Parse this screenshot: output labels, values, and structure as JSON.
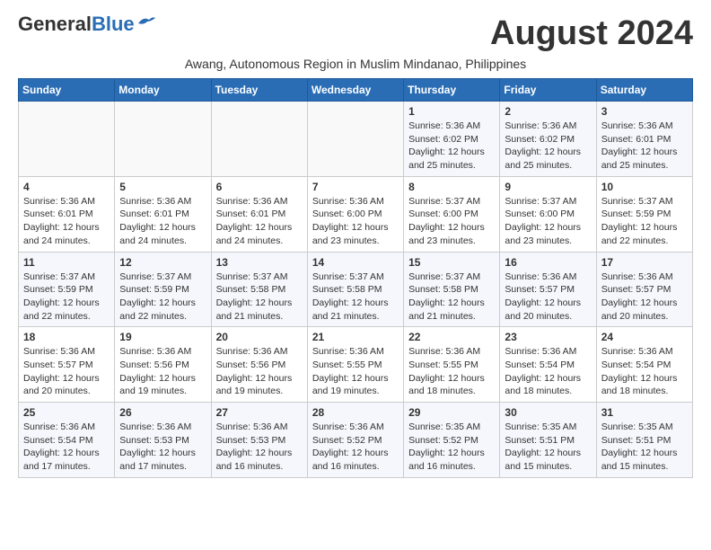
{
  "header": {
    "logo_general": "General",
    "logo_blue": "Blue",
    "month_title": "August 2024",
    "subtitle": "Awang, Autonomous Region in Muslim Mindanao, Philippines"
  },
  "weekdays": [
    "Sunday",
    "Monday",
    "Tuesday",
    "Wednesday",
    "Thursday",
    "Friday",
    "Saturday"
  ],
  "weeks": [
    [
      {
        "day": "",
        "info": ""
      },
      {
        "day": "",
        "info": ""
      },
      {
        "day": "",
        "info": ""
      },
      {
        "day": "",
        "info": ""
      },
      {
        "day": "1",
        "info": "Sunrise: 5:36 AM\nSunset: 6:02 PM\nDaylight: 12 hours\nand 25 minutes."
      },
      {
        "day": "2",
        "info": "Sunrise: 5:36 AM\nSunset: 6:02 PM\nDaylight: 12 hours\nand 25 minutes."
      },
      {
        "day": "3",
        "info": "Sunrise: 5:36 AM\nSunset: 6:01 PM\nDaylight: 12 hours\nand 25 minutes."
      }
    ],
    [
      {
        "day": "4",
        "info": "Sunrise: 5:36 AM\nSunset: 6:01 PM\nDaylight: 12 hours\nand 24 minutes."
      },
      {
        "day": "5",
        "info": "Sunrise: 5:36 AM\nSunset: 6:01 PM\nDaylight: 12 hours\nand 24 minutes."
      },
      {
        "day": "6",
        "info": "Sunrise: 5:36 AM\nSunset: 6:01 PM\nDaylight: 12 hours\nand 24 minutes."
      },
      {
        "day": "7",
        "info": "Sunrise: 5:36 AM\nSunset: 6:00 PM\nDaylight: 12 hours\nand 23 minutes."
      },
      {
        "day": "8",
        "info": "Sunrise: 5:37 AM\nSunset: 6:00 PM\nDaylight: 12 hours\nand 23 minutes."
      },
      {
        "day": "9",
        "info": "Sunrise: 5:37 AM\nSunset: 6:00 PM\nDaylight: 12 hours\nand 23 minutes."
      },
      {
        "day": "10",
        "info": "Sunrise: 5:37 AM\nSunset: 5:59 PM\nDaylight: 12 hours\nand 22 minutes."
      }
    ],
    [
      {
        "day": "11",
        "info": "Sunrise: 5:37 AM\nSunset: 5:59 PM\nDaylight: 12 hours\nand 22 minutes."
      },
      {
        "day": "12",
        "info": "Sunrise: 5:37 AM\nSunset: 5:59 PM\nDaylight: 12 hours\nand 22 minutes."
      },
      {
        "day": "13",
        "info": "Sunrise: 5:37 AM\nSunset: 5:58 PM\nDaylight: 12 hours\nand 21 minutes."
      },
      {
        "day": "14",
        "info": "Sunrise: 5:37 AM\nSunset: 5:58 PM\nDaylight: 12 hours\nand 21 minutes."
      },
      {
        "day": "15",
        "info": "Sunrise: 5:37 AM\nSunset: 5:58 PM\nDaylight: 12 hours\nand 21 minutes."
      },
      {
        "day": "16",
        "info": "Sunrise: 5:36 AM\nSunset: 5:57 PM\nDaylight: 12 hours\nand 20 minutes."
      },
      {
        "day": "17",
        "info": "Sunrise: 5:36 AM\nSunset: 5:57 PM\nDaylight: 12 hours\nand 20 minutes."
      }
    ],
    [
      {
        "day": "18",
        "info": "Sunrise: 5:36 AM\nSunset: 5:57 PM\nDaylight: 12 hours\nand 20 minutes."
      },
      {
        "day": "19",
        "info": "Sunrise: 5:36 AM\nSunset: 5:56 PM\nDaylight: 12 hours\nand 19 minutes."
      },
      {
        "day": "20",
        "info": "Sunrise: 5:36 AM\nSunset: 5:56 PM\nDaylight: 12 hours\nand 19 minutes."
      },
      {
        "day": "21",
        "info": "Sunrise: 5:36 AM\nSunset: 5:55 PM\nDaylight: 12 hours\nand 19 minutes."
      },
      {
        "day": "22",
        "info": "Sunrise: 5:36 AM\nSunset: 5:55 PM\nDaylight: 12 hours\nand 18 minutes."
      },
      {
        "day": "23",
        "info": "Sunrise: 5:36 AM\nSunset: 5:54 PM\nDaylight: 12 hours\nand 18 minutes."
      },
      {
        "day": "24",
        "info": "Sunrise: 5:36 AM\nSunset: 5:54 PM\nDaylight: 12 hours\nand 18 minutes."
      }
    ],
    [
      {
        "day": "25",
        "info": "Sunrise: 5:36 AM\nSunset: 5:54 PM\nDaylight: 12 hours\nand 17 minutes."
      },
      {
        "day": "26",
        "info": "Sunrise: 5:36 AM\nSunset: 5:53 PM\nDaylight: 12 hours\nand 17 minutes."
      },
      {
        "day": "27",
        "info": "Sunrise: 5:36 AM\nSunset: 5:53 PM\nDaylight: 12 hours\nand 16 minutes."
      },
      {
        "day": "28",
        "info": "Sunrise: 5:36 AM\nSunset: 5:52 PM\nDaylight: 12 hours\nand 16 minutes."
      },
      {
        "day": "29",
        "info": "Sunrise: 5:35 AM\nSunset: 5:52 PM\nDaylight: 12 hours\nand 16 minutes."
      },
      {
        "day": "30",
        "info": "Sunrise: 5:35 AM\nSunset: 5:51 PM\nDaylight: 12 hours\nand 15 minutes."
      },
      {
        "day": "31",
        "info": "Sunrise: 5:35 AM\nSunset: 5:51 PM\nDaylight: 12 hours\nand 15 minutes."
      }
    ]
  ]
}
